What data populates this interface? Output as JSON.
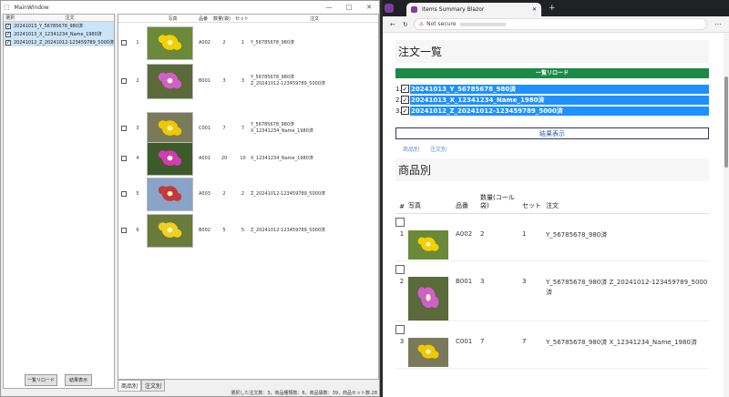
{
  "app": {
    "window_title": "MainWindow",
    "minimize": "—",
    "maximize": "□",
    "close": "✕"
  },
  "left_panel": {
    "headers": [
      "選択",
      "注文"
    ],
    "items": [
      {
        "label": "20241013_Y_56785678_980済",
        "checked": true
      },
      {
        "label": "20241013_X_12341234_Name_1980済",
        "checked": true
      },
      {
        "label": "20241012_Z_20241012-123459789_5000済",
        "checked": true
      }
    ],
    "reload_button": "一覧リロード",
    "result_button": "結果表示"
  },
  "grid": {
    "headers": [
      "",
      "",
      "写真",
      "品番",
      "数量(袋)",
      "セット",
      "注文"
    ],
    "rows": [
      {
        "index": "1",
        "code": "A002",
        "qty": "2",
        "set": "1",
        "order": "Y_56785678_980済",
        "color": "#6a8a3a",
        "flower": "#f5d000"
      },
      {
        "index": "2",
        "code": "B001",
        "qty": "3",
        "set": "3",
        "order": "Y_56785678_980済\nZ_20241012-123459789_5000済",
        "color": "#5b6a3a",
        "flower": "#d05fc9"
      },
      {
        "index": "3",
        "code": "C001",
        "qty": "7",
        "set": "7",
        "order": "Y_56785678_980済\nX_12341234_Name_1980済",
        "color": "#7a7a5a",
        "flower": "#f0c800"
      },
      {
        "index": "4",
        "code": "A001",
        "qty": "20",
        "set": "10",
        "order": "X_12341234_Name_1980済",
        "color": "#3d5a2a",
        "flower": "#d43ab5"
      },
      {
        "index": "5",
        "code": "A003",
        "qty": "2",
        "set": "2",
        "order": "Z_20241012-123459789_5000済",
        "color": "#8aa3c8",
        "flower": "#c23a3a"
      },
      {
        "index": "6",
        "code": "B002",
        "qty": "5",
        "set": "5",
        "order": "Z_20241012-123459789_5000済",
        "color": "#6a7a3a",
        "flower": "#f0d020"
      }
    ]
  },
  "tabs": [
    "商品別",
    "注文別"
  ],
  "status_text": "選択した注文数：3，商品種類数：6，商品袋数：39，商品セット数:28",
  "browser": {
    "tab_title": "Items Summary Blazor",
    "new_tab": "+",
    "security": "Not secure",
    "nav": {
      "back": "←",
      "refresh": "↻"
    },
    "heading_orders": "注文一覧",
    "reload_button": "一覧リロード",
    "orders": [
      {
        "n": "1.",
        "label": "20241013_Y_56785678_980済"
      },
      {
        "n": "2.",
        "label": "20241013_X_12341234_Name_1980済"
      },
      {
        "n": "3.",
        "label": "20241012_Z_20241012-123459789_5000済"
      }
    ],
    "result_button": "結果表示",
    "links": [
      "商品別",
      "注文別"
    ],
    "heading_items": "商品別",
    "table_headers": [
      "#",
      "写真",
      "品番",
      "数量(コール袋)",
      "セット",
      "注文"
    ],
    "rows": [
      {
        "n": "1",
        "code": "A002",
        "qty": "2",
        "set": "1",
        "order": "Y_56785678_980済"
      },
      {
        "n": "2",
        "code": "B001",
        "qty": "3",
        "set": "3",
        "order": "Y_56785678_980済 Z_20241012-123459789_5000済"
      },
      {
        "n": "3",
        "code": "C001",
        "qty": "7",
        "set": "7",
        "order": "Y_56785678_980済 X_12341234_Name_1980済"
      }
    ]
  }
}
